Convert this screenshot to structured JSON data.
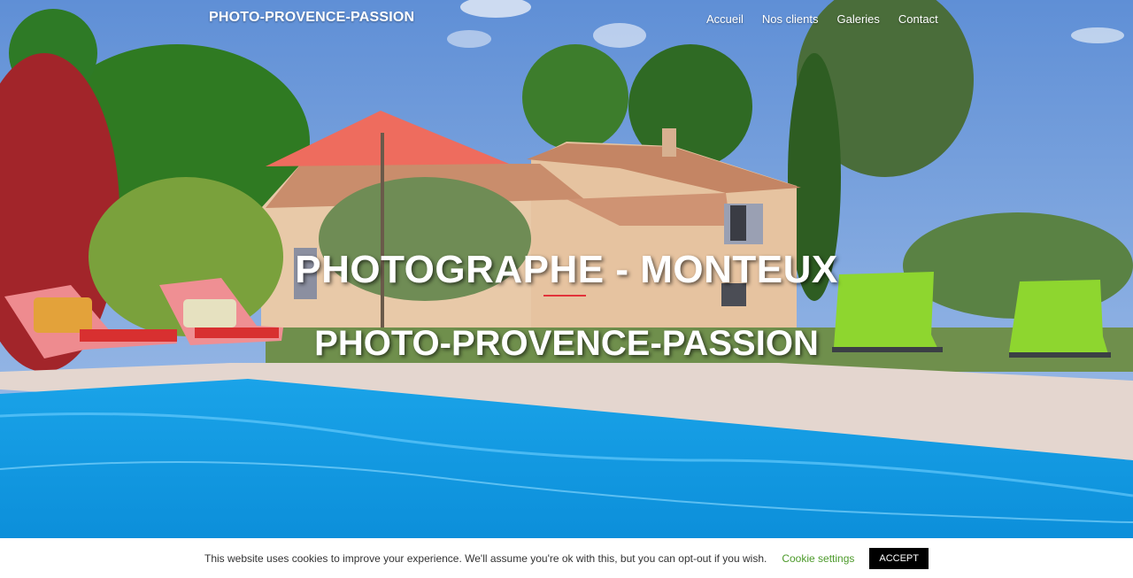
{
  "header": {
    "site_title": "PHOTO-PROVENCE-PASSION",
    "nav": [
      "Accueil",
      "Nos clients",
      "Galeries",
      "Contact"
    ]
  },
  "hero": {
    "title": "PHOTOGRAPHE - MONTEUX",
    "subtitle": "PHOTO-PROVENCE-PASSION",
    "accent_color": "#e2333a"
  },
  "cookie": {
    "message": "This website uses cookies to improve your experience. We'll assume you're ok with this, but you can opt-out if you wish.",
    "settings_label": "Cookie settings",
    "accept_label": "ACCEPT"
  }
}
